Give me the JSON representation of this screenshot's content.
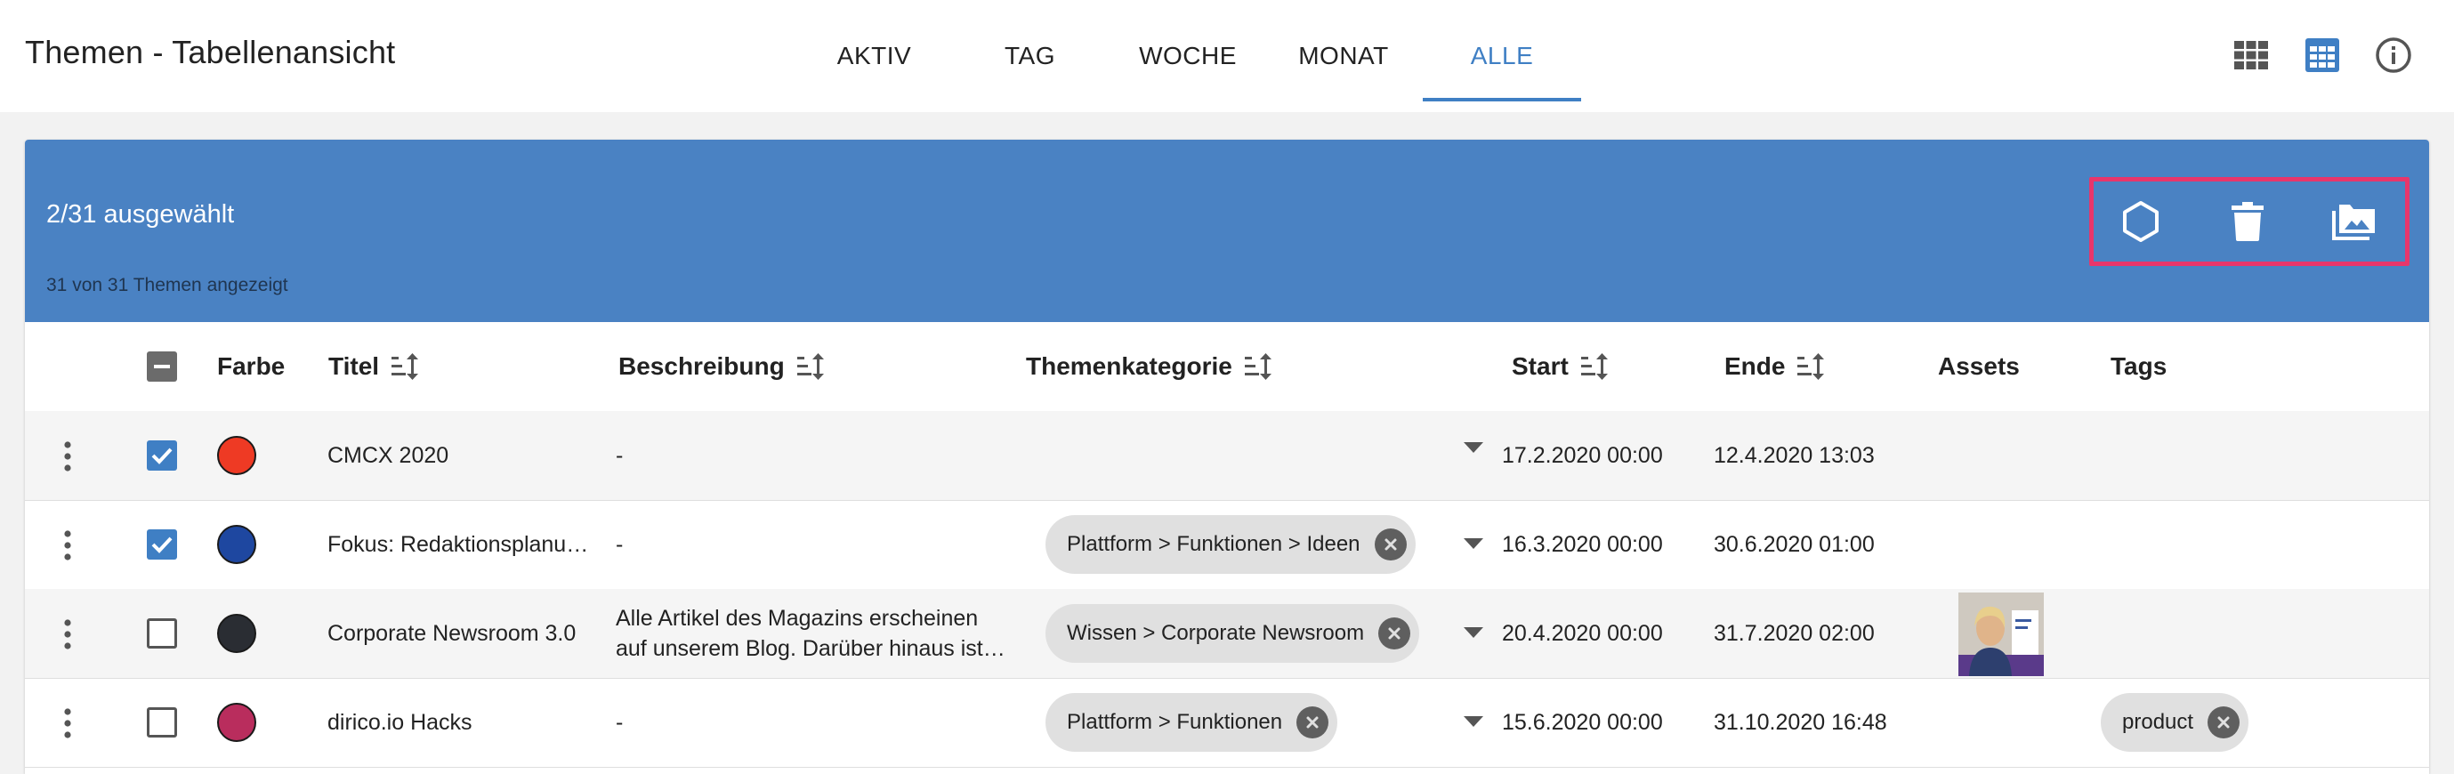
{
  "page": {
    "title": "Themen - Tabellenansicht"
  },
  "tabs": [
    {
      "label": "AKTIV",
      "active": false
    },
    {
      "label": "TAG",
      "active": false
    },
    {
      "label": "WOCHE",
      "active": false
    },
    {
      "label": "MONAT",
      "active": false
    },
    {
      "label": "ALLE",
      "active": true
    }
  ],
  "top_icons": [
    "grid-view-icon",
    "table-view-icon",
    "info-icon"
  ],
  "selection": {
    "selected_text": "2/31 ausgewählt",
    "shown_text": "31 von 31 Themen angezeigt",
    "actions": [
      "hexagon-icon",
      "trash-icon",
      "image-folder-icon"
    ],
    "highlight_color": "#e8366b"
  },
  "table": {
    "headers": {
      "color": "Farbe",
      "title": "Titel",
      "description": "Beschreibung",
      "category": "Themenkategorie",
      "start": "Start",
      "end": "Ende",
      "assets": "Assets",
      "tags": "Tags"
    },
    "rows": [
      {
        "checked": true,
        "color": "#ee3a24",
        "title": "CMCX 2020",
        "desc1": "-",
        "desc2": "",
        "category": "",
        "start": "17.2.2020 00:00",
        "end": "12.4.2020 13:03",
        "has_asset": false,
        "tag": ""
      },
      {
        "checked": true,
        "color": "#1e47a0",
        "title": "Fokus: Redaktionsplanu…",
        "desc1": "-",
        "desc2": "",
        "category": "Plattform > Funktionen > Ideen",
        "start": "16.3.2020 00:00",
        "end": "30.6.2020 01:00",
        "has_asset": false,
        "tag": ""
      },
      {
        "checked": false,
        "color": "#2a2d33",
        "title": "Corporate Newsroom 3.0",
        "desc1": "Alle Artikel des Magazins erscheinen",
        "desc2": "auf unserem Blog. Darüber hinaus ist…",
        "category": "Wissen > Corporate Newsroom",
        "start": "20.4.2020 00:00",
        "end": "31.7.2020 02:00",
        "has_asset": true,
        "tag": ""
      },
      {
        "checked": false,
        "color": "#b92d5d",
        "title": "dirico.io Hacks",
        "desc1": "-",
        "desc2": "",
        "category": "Plattform > Funktionen",
        "start": "15.6.2020 00:00",
        "end": "31.10.2020 16:48",
        "has_asset": false,
        "tag": "product"
      }
    ]
  },
  "colors": {
    "accent": "#3f7fc4",
    "banner": "#4a82c3"
  }
}
